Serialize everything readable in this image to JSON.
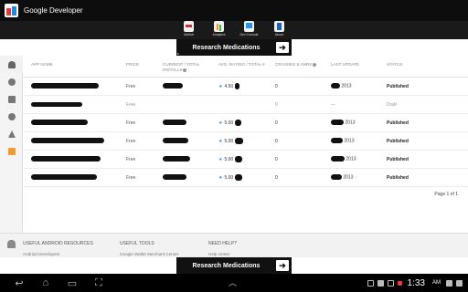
{
  "app": {
    "title": "Google Developer"
  },
  "icon_strip": [
    {
      "label": "AdMob",
      "icon": "admob-icon"
    },
    {
      "label": "Analytics",
      "icon": "analytics-icon"
    },
    {
      "label": "Dev Console",
      "icon": "dev-console-icon"
    },
    {
      "label": "About",
      "icon": "about-icon"
    }
  ],
  "banner": {
    "text": "Research Medications",
    "arrow": "➔",
    "ad_marker": "▸"
  },
  "nav_icons": [
    "android-icon",
    "gamepad-icon",
    "services-icon",
    "settings-icon",
    "alerts-icon",
    "announcements-icon"
  ],
  "table": {
    "columns": {
      "name": "APP NAME",
      "price": "PRICE",
      "installs": "CURRENT / TOTAL INSTALLS",
      "rating": "AVG. RATING / TOTAL #",
      "crashes": "CRASHES & ANRS",
      "update": "LAST UPDATE",
      "status": "STATUS"
    },
    "rows": [
      {
        "price": "Free",
        "rating": "4.50",
        "crashes": "0",
        "update": "2013",
        "status": "Published"
      },
      {
        "price": "Free",
        "rating": "",
        "crashes": "0",
        "update": "—",
        "status": "Draft"
      },
      {
        "price": "Free",
        "rating": "5.00",
        "crashes": "0",
        "update": "2013",
        "status": "Published"
      },
      {
        "price": "Free",
        "rating": "5.00",
        "crashes": "0",
        "update": "2013",
        "status": "Published"
      },
      {
        "price": "Free",
        "rating": "5.00",
        "crashes": "0",
        "update": "2013",
        "status": "Published"
      },
      {
        "price": "Free",
        "rating": "5.00",
        "crashes": "0",
        "update": "2013",
        "status": "Published"
      }
    ],
    "pager": "Page 1 of 1"
  },
  "footer": {
    "resources": {
      "heading": "USEFUL ANDROID RESOURCES",
      "link": "Android Developers"
    },
    "tools": {
      "heading": "USEFUL TOOLS",
      "link": "Google Wallet Merchant Center"
    },
    "help": {
      "heading": "NEED HELP?",
      "link": "Help center"
    }
  },
  "system_bar": {
    "time": "1:33",
    "ampm": "AM"
  }
}
